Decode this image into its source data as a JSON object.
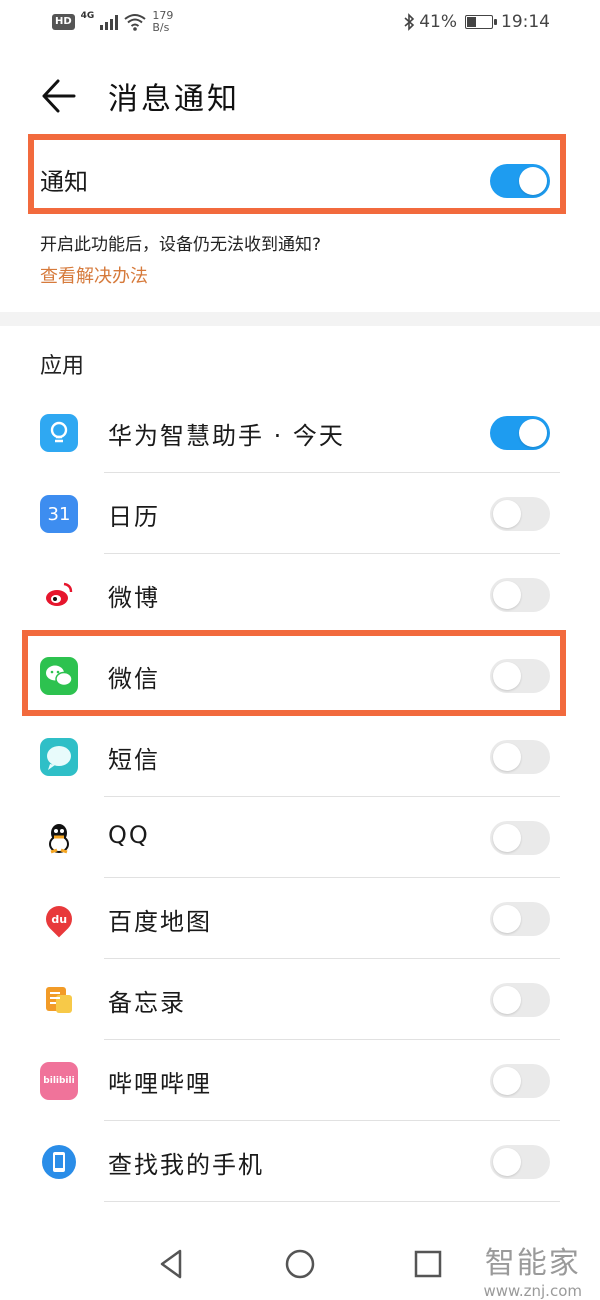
{
  "status": {
    "hd": "HD",
    "net": "4G",
    "speed_value": "179",
    "speed_unit": "B/s",
    "battery": "41%",
    "time": "19:14"
  },
  "header": {
    "title": "消息通知"
  },
  "notification": {
    "label": "通知",
    "enabled": true,
    "hint": "开启此功能后，设备仍无法收到通知?",
    "link": "查看解决办法"
  },
  "section_title": "应用",
  "apps": [
    {
      "name": "华为智慧助手 · 今天",
      "icon": "huawei-assistant-icon",
      "color": "#2fa8f2",
      "enabled": true
    },
    {
      "name": "日历",
      "icon": "calendar-icon",
      "color": "#3d8df0",
      "icon_text": "31",
      "enabled": false
    },
    {
      "name": "微博",
      "icon": "weibo-icon",
      "color": "#f7c948",
      "enabled": false
    },
    {
      "name": "微信",
      "icon": "wechat-icon",
      "color": "#2dc24f",
      "enabled": false
    },
    {
      "name": "短信",
      "icon": "messages-icon",
      "color": "#2fbfc7",
      "enabled": false
    },
    {
      "name": "QQ",
      "icon": "qq-icon",
      "color": "#111111",
      "enabled": false
    },
    {
      "name": "百度地图",
      "icon": "baidu-maps-icon",
      "color": "#e8393b",
      "icon_text": "du",
      "enabled": false
    },
    {
      "name": "备忘录",
      "icon": "notes-icon",
      "color": "#f29b27",
      "enabled": false
    },
    {
      "name": "哔哩哔哩",
      "icon": "bilibili-icon",
      "color": "#f0739a",
      "icon_text": "bilibili",
      "enabled": false
    },
    {
      "name": "查找我的手机",
      "icon": "find-phone-icon",
      "color": "#2a8de8",
      "enabled": false
    }
  ],
  "watermark": {
    "cn": "智能家",
    "url": "www.znj.com"
  },
  "colors": {
    "accent": "#1e9cf0",
    "highlight": "#f26a3d",
    "link": "#d67a3b"
  }
}
